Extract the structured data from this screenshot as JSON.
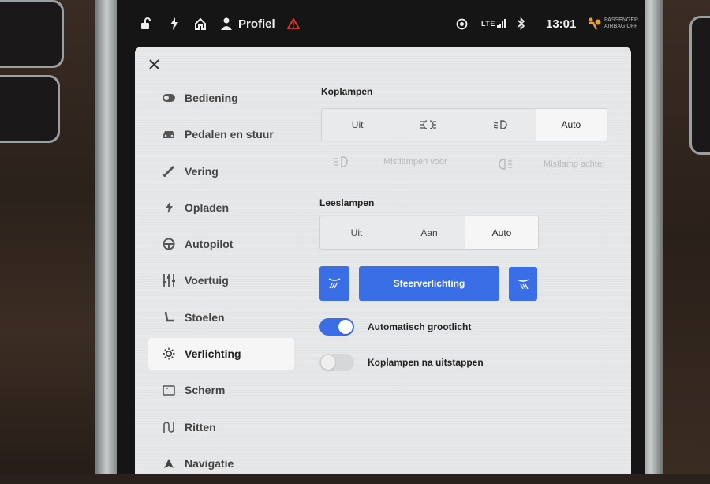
{
  "status_bar": {
    "profile_label": "Profiel",
    "network": "LTE",
    "time": "13:01",
    "airbag_line1": "PASSENGER",
    "airbag_line2": "AIRBAG OFF",
    "icons": [
      "lock-open-icon",
      "lightning-icon",
      "home-icon",
      "person-icon",
      "warning-icon",
      "camera-icon",
      "signal-icon",
      "bluetooth-icon",
      "airbag-icon"
    ]
  },
  "sidebar": {
    "items": [
      {
        "label": "Bediening",
        "icon": "toggle-icon"
      },
      {
        "label": "Pedalen en stuur",
        "icon": "car-icon"
      },
      {
        "label": "Vering",
        "icon": "suspension-icon"
      },
      {
        "label": "Opladen",
        "icon": "lightning-icon"
      },
      {
        "label": "Autopilot",
        "icon": "steering-wheel-icon"
      },
      {
        "label": "Voertuig",
        "icon": "sliders-icon"
      },
      {
        "label": "Stoelen",
        "icon": "seat-icon"
      },
      {
        "label": "Verlichting",
        "icon": "sun-icon",
        "active": true
      },
      {
        "label": "Scherm",
        "icon": "screen-icon"
      },
      {
        "label": "Ritten",
        "icon": "trip-icon"
      },
      {
        "label": "Navigatie",
        "icon": "navigation-icon"
      }
    ]
  },
  "headlights": {
    "title": "Koplampen",
    "options": [
      "Uit",
      "",
      "",
      "Auto"
    ],
    "option_icons": [
      "",
      "parking-lights-icon",
      "low-beam-icon",
      ""
    ],
    "selected": "Auto"
  },
  "fog": {
    "front_label": "Mistlampen voor",
    "rear_label": "Mistlamp achter"
  },
  "reading_lights": {
    "title": "Leeslampen",
    "options": [
      "Uit",
      "Aan",
      "Auto"
    ],
    "selected": "Auto"
  },
  "ambient": {
    "label": "Sfeerverlichting"
  },
  "toggles": [
    {
      "label": "Automatisch grootlicht",
      "on": true
    },
    {
      "label": "Koplampen na uitstappen",
      "on": false
    }
  ],
  "colors": {
    "accent": "#3a6ee6",
    "screen_bg": "#e7e8ea",
    "warning": "#e0392b"
  }
}
